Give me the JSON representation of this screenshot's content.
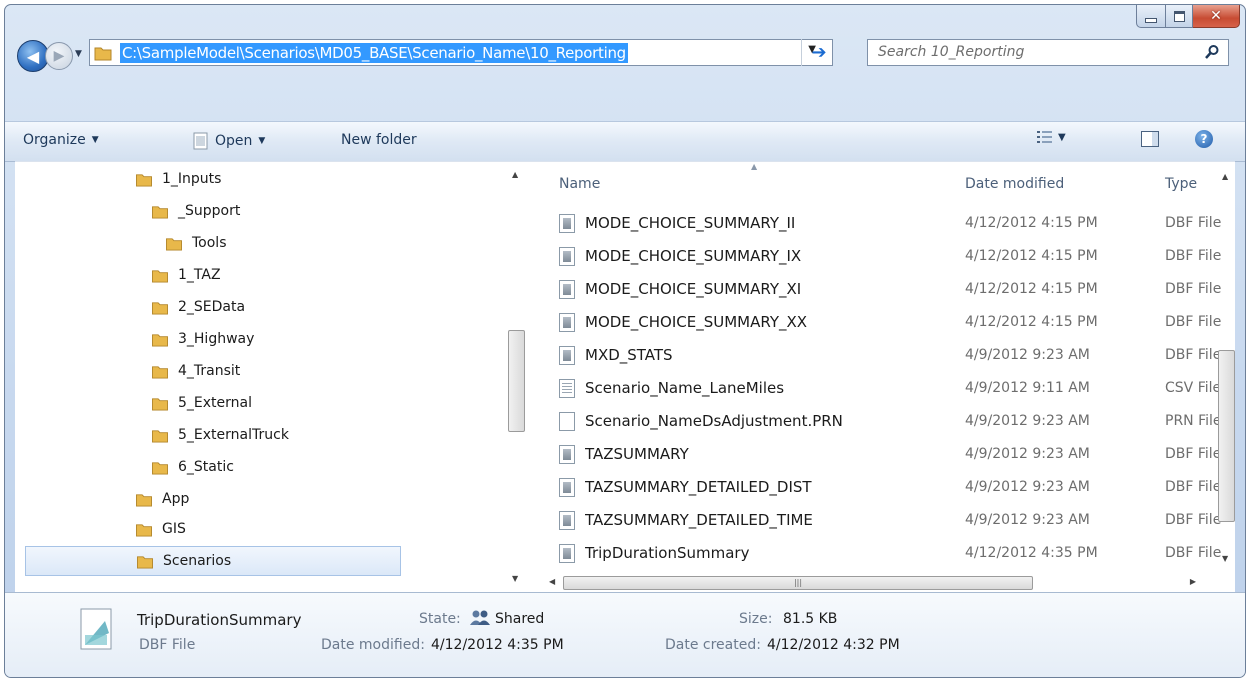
{
  "address": {
    "path": "C:\\SampleModel\\Scenarios\\MD05_BASE\\Scenario_Name\\10_Reporting"
  },
  "search": {
    "placeholder": "Search 10_Reporting"
  },
  "toolbar": {
    "organize_label": "Organize",
    "open_label": "Open",
    "new_folder_label": "New folder"
  },
  "nav_tree": [
    {
      "label": "1_Inputs"
    },
    {
      "label": "_Support"
    },
    {
      "label": "Tools"
    },
    {
      "label": "1_TAZ"
    },
    {
      "label": "2_SEData"
    },
    {
      "label": "3_Highway"
    },
    {
      "label": "4_Transit"
    },
    {
      "label": "5_External"
    },
    {
      "label": "5_ExternalTruck"
    },
    {
      "label": "6_Static"
    },
    {
      "label": "App"
    },
    {
      "label": "GIS"
    },
    {
      "label": "Scenarios"
    }
  ],
  "columns": {
    "name": "Name",
    "date": "Date modified",
    "type": "Type"
  },
  "files": [
    {
      "name": "MODE_CHOICE_SUMMARY_II",
      "date": "4/12/2012 4:15 PM",
      "type": "DBF File",
      "icon": "dbf"
    },
    {
      "name": "MODE_CHOICE_SUMMARY_IX",
      "date": "4/12/2012 4:15 PM",
      "type": "DBF File",
      "icon": "dbf"
    },
    {
      "name": "MODE_CHOICE_SUMMARY_XI",
      "date": "4/12/2012 4:15 PM",
      "type": "DBF File",
      "icon": "dbf"
    },
    {
      "name": "MODE_CHOICE_SUMMARY_XX",
      "date": "4/12/2012 4:15 PM",
      "type": "DBF File",
      "icon": "dbf"
    },
    {
      "name": "MXD_STATS",
      "date": "4/9/2012 9:23 AM",
      "type": "DBF File",
      "icon": "dbf"
    },
    {
      "name": "Scenario_Name_LaneMiles",
      "date": "4/9/2012 9:11 AM",
      "type": "CSV File",
      "icon": "csv"
    },
    {
      "name": "Scenario_NameDsAdjustment.PRN",
      "date": "4/9/2012 9:23 AM",
      "type": "PRN File",
      "icon": "prn"
    },
    {
      "name": "TAZSUMMARY",
      "date": "4/9/2012 9:23 AM",
      "type": "DBF File",
      "icon": "dbf"
    },
    {
      "name": "TAZSUMMARY_DETAILED_DIST",
      "date": "4/9/2012 9:23 AM",
      "type": "DBF File",
      "icon": "dbf"
    },
    {
      "name": "TAZSUMMARY_DETAILED_TIME",
      "date": "4/9/2012 9:23 AM",
      "type": "DBF File",
      "icon": "dbf"
    },
    {
      "name": "TripDurationSummary",
      "date": "4/12/2012 4:35 PM",
      "type": "DBF File",
      "icon": "dbf"
    }
  ],
  "details": {
    "name": "TripDurationSummary",
    "type": "DBF File",
    "state_label": "State:",
    "state_value": "Shared",
    "size_label": "Size:",
    "size_value": "81.5 KB",
    "date_modified_label": "Date modified:",
    "date_modified_value": "4/12/2012 4:35 PM",
    "date_created_label": "Date created:",
    "date_created_value": "4/12/2012 4:32 PM"
  },
  "colors": {
    "selection": "#3399ff",
    "folder": "#e8b84a",
    "chrome": "#c8d9ef"
  }
}
